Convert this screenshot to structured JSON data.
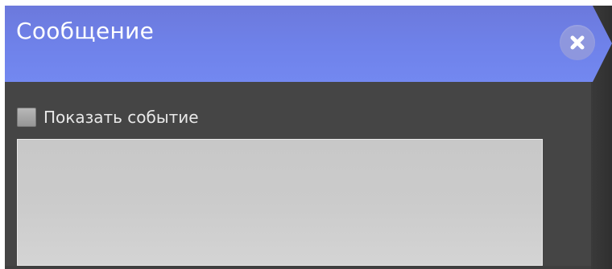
{
  "dialog": {
    "title": "Сообщение",
    "close_icon": "close-icon"
  },
  "form": {
    "show_event_label": "Показать событие",
    "show_event_checked": false,
    "message_value": ""
  },
  "colors": {
    "header": "#6f82ea",
    "panel": "#454545",
    "close_button": "#8e97de",
    "message_box": "#cbcbcb"
  }
}
